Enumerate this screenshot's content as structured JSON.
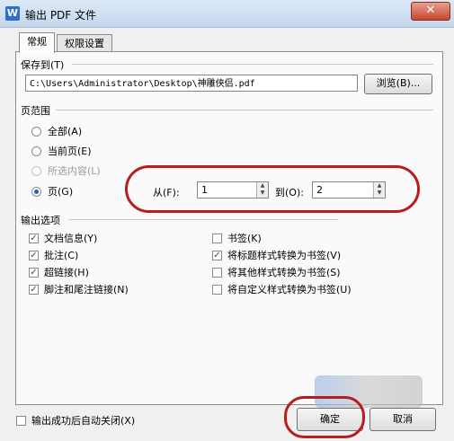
{
  "window": {
    "title": "输出 PDF 文件",
    "close_glyph": "✕",
    "app_icon_letter": "W"
  },
  "tabs": [
    {
      "label": "常规",
      "active": true
    },
    {
      "label": "权限设置",
      "active": false
    }
  ],
  "save_section": {
    "title": "保存到(T)",
    "path": "C:\\Users\\Administrator\\Desktop\\神雕侠侣.pdf",
    "browse_label": "浏览(B)..."
  },
  "range_section": {
    "title": "页范围",
    "options": [
      {
        "label": "全部(A)",
        "selected": false,
        "enabled": true
      },
      {
        "label": "当前页(E)",
        "selected": false,
        "enabled": true
      },
      {
        "label": "所选内容(L)",
        "selected": false,
        "enabled": false
      },
      {
        "label": "页(G)",
        "selected": true,
        "enabled": true
      }
    ],
    "from_label": "从(F):",
    "from_value": "1",
    "to_label": "到(O):",
    "to_value": "2"
  },
  "output_section": {
    "title": "输出选项",
    "left_options": [
      {
        "label": "文档信息(Y)",
        "checked": true
      },
      {
        "label": "批注(C)",
        "checked": true
      },
      {
        "label": "超链接(H)",
        "checked": true
      },
      {
        "label": "脚注和尾注链接(N)",
        "checked": true
      }
    ],
    "right_options": [
      {
        "label": "书签(K)",
        "checked": false
      },
      {
        "label": "将标题样式转换为书签(V)",
        "checked": true
      },
      {
        "label": "将其他样式转换为书签(S)",
        "checked": false
      },
      {
        "label": "将自定义样式转换为书签(U)",
        "checked": false
      }
    ]
  },
  "footer": {
    "auto_close_label": "输出成功后自动关闭(X)",
    "auto_close_checked": false,
    "ok_label": "确定",
    "cancel_label": "取消"
  },
  "icons": {
    "check": "✓",
    "spin_up": "▲",
    "spin_down": "▼"
  },
  "colors": {
    "annotation_red": "#b81c1c",
    "title_bar": "#c5d7ee"
  }
}
